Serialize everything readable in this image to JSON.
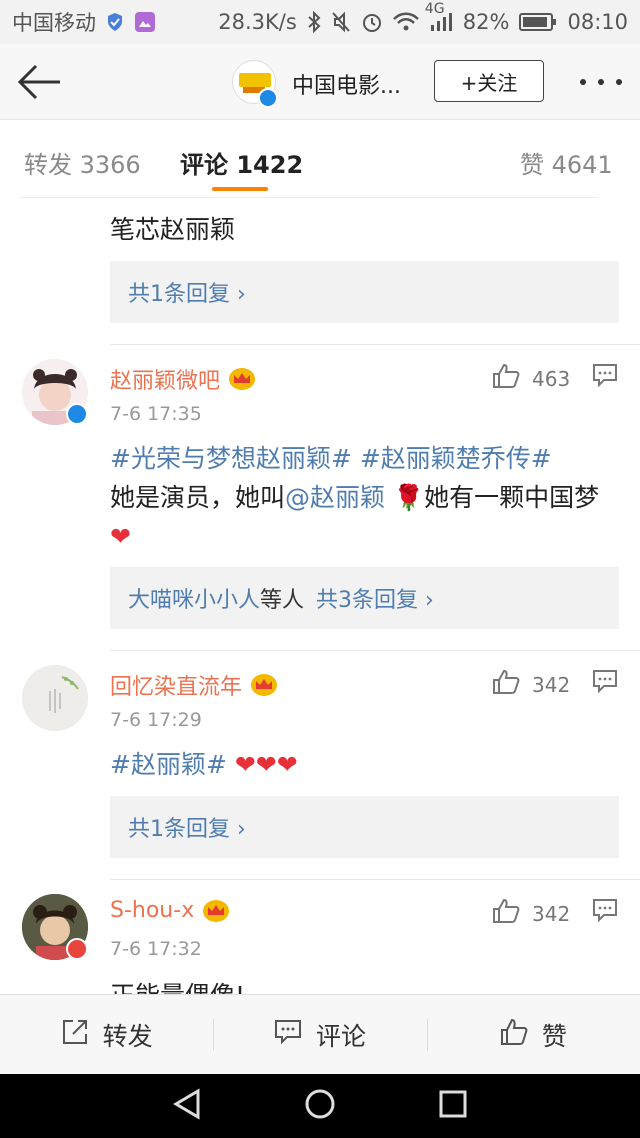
{
  "status_bar": {
    "carrier": "中国移动",
    "speed": "28.3K/s",
    "network": "4G",
    "battery": "82%",
    "time": "08:10"
  },
  "header": {
    "account_name": "中国电影...",
    "follow_label": "+关注"
  },
  "tabs": [
    {
      "label": "转发 3366"
    },
    {
      "label": "评论 1422"
    },
    {
      "label": "赞 4641"
    }
  ],
  "comments": [
    {
      "text_tail": "笔芯赵丽颖",
      "reply_summary": "共1条回复 ›"
    },
    {
      "username": "赵丽颖微吧",
      "time": "7-6 17:35",
      "likes": "463",
      "topic1": "#光荣与梦想赵丽颖#",
      "topic2": "#赵丽颖楚乔传#",
      "text_a": "她是演员，她叫",
      "mention": "@赵丽颖",
      "text_b": "她有一颗中国梦",
      "reply_users": "大喵咪小小人",
      "reply_mid": "等人",
      "reply_count": "共3条回复 ›"
    },
    {
      "username": "回忆染直流年",
      "time": "7-6 17:29",
      "likes": "342",
      "topic1": "#赵丽颖#",
      "reply_summary": "共1条回复 ›"
    },
    {
      "username": "S-hou-x",
      "time": "7-6 17:32",
      "likes": "342",
      "text": "正能量偶像!"
    }
  ],
  "actions": {
    "repost": "转发",
    "comment": "评论",
    "like": "赞"
  },
  "colors": {
    "accent": "#ff8200",
    "username": "#eb7350",
    "link": "#507daf"
  }
}
